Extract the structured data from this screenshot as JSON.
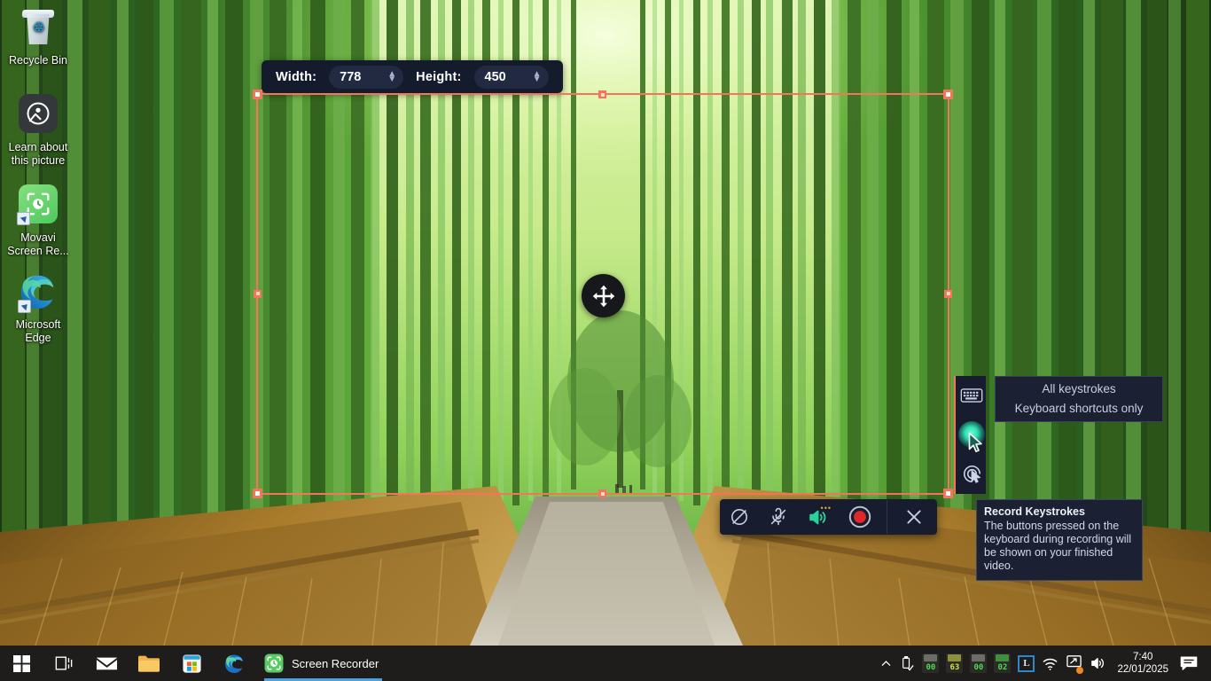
{
  "desktop": {
    "icons": [
      {
        "label": "Recycle Bin",
        "icon": "recycle-bin-icon"
      },
      {
        "label": "Learn about\nthis picture",
        "label_line1": "Learn about",
        "label_line2": "this picture",
        "icon": "spotlight-picture-icon"
      },
      {
        "label_line1": "Movavi",
        "label_line2": "Screen Re...",
        "icon": "movavi-screen-recorder-icon"
      },
      {
        "label_line1": "Microsoft",
        "label_line2": "Edge",
        "icon": "microsoft-edge-icon"
      }
    ]
  },
  "size_toolbar": {
    "width_label": "Width:",
    "width_value": "778",
    "height_label": "Height:",
    "height_value": "450"
  },
  "capture": {
    "frame_color": "#f4765a",
    "move_handle_icon": "move-arrows-icon"
  },
  "control_bar": {
    "buttons": [
      {
        "name": "webcam-off-button",
        "icon": "webcam-off-icon",
        "state": "off"
      },
      {
        "name": "microphone-off-button",
        "icon": "microphone-off-icon",
        "state": "off"
      },
      {
        "name": "system-audio-button",
        "icon": "speaker-on-icon",
        "state": "on",
        "color": "#26d39a"
      },
      {
        "name": "record-button",
        "icon": "record-icon",
        "color": "#e0272a"
      },
      {
        "name": "close-button",
        "icon": "close-x-icon"
      }
    ]
  },
  "tool_rail": {
    "buttons": [
      {
        "name": "record-keystrokes-button",
        "icon": "keyboard-icon"
      },
      {
        "name": "highlight-cursor-button",
        "icon": "cursor-highlight-icon",
        "glow_color": "#31e3b4"
      },
      {
        "name": "show-clicks-button",
        "icon": "click-effect-icon"
      }
    ]
  },
  "keystroke_menu": {
    "items": [
      {
        "label": "All keystrokes"
      },
      {
        "label": "Keyboard shortcuts only"
      }
    ]
  },
  "tooltip": {
    "title": "Record Keystrokes",
    "body": "The buttons pressed on the keyboard during recording will be shown on your finished video."
  },
  "taskbar": {
    "buttons": [
      {
        "name": "start-button",
        "icon": "windows-logo-icon"
      },
      {
        "name": "task-view-button",
        "icon": "task-view-icon"
      },
      {
        "name": "mail-button",
        "icon": "mail-icon"
      },
      {
        "name": "file-explorer-button",
        "icon": "folder-icon"
      },
      {
        "name": "microsoft-store-button",
        "icon": "store-icon"
      },
      {
        "name": "edge-button",
        "icon": "microsoft-edge-icon"
      }
    ],
    "active_app": {
      "label": "Screen Recorder",
      "icon": "movavi-screen-recorder-icon"
    },
    "tray": {
      "overflow_icon": "chevron-up-icon",
      "usb_icon": "usb-eject-icon",
      "monitors": [
        {
          "name": "monitor-widget-1",
          "value": "00"
        },
        {
          "name": "monitor-widget-2",
          "value": "63"
        },
        {
          "name": "monitor-widget-3",
          "value": "00"
        },
        {
          "name": "monitor-widget-4",
          "value": "02"
        }
      ],
      "app_icon_letter": "L",
      "wifi_icon": "wifi-icon",
      "network_icon": "network-alert-icon",
      "volume_icon": "volume-icon",
      "clock_time": "7:40",
      "clock_date": "22/01/2025",
      "notification_icon": "notification-icon"
    }
  }
}
